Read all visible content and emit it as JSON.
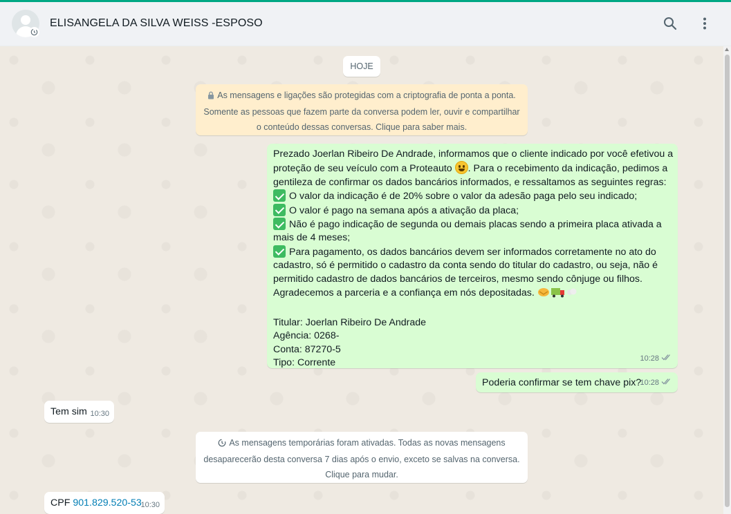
{
  "header": {
    "contact_name": "ELISANGELA DA SILVA WEISS -ESPOSO",
    "search_icon": "search-icon",
    "menu_icon": "more-vertical-icon"
  },
  "chat": {
    "date_chip": "HOJE",
    "encryption_note": [
      "As mensagens e ligações são protegidas com a criptografia de ponta a ponta.",
      "Somente as pessoas que fazem parte da conversa podem ler, ouvir e compartilhar",
      "o conteúdo dessas conversas. Clique para saber mais."
    ],
    "main_message": {
      "lines": [
        "Prezado Joerlan Ribeiro De Andrade, informamos que o cliente indicado por você efetivou a",
        "proteção de seu veículo com a Proteauto",
        ". Para o recebimento da indicação, pedimos a",
        "gentileza de confirmar os dados bancários informados, e  ressaltamos as seguintes regras:",
        "O valor da indicação é de 20% sobre o valor da adesão paga pelo seu indicado;",
        "O valor é pago na semana após a ativação da placa;",
        "Não é pago indicação de segunda ou demais placas sendo a primeira placa ativada a",
        "mais de 4 meses;",
        "Para pagamento, os dados bancários devem ser informados corretamente no ato do",
        "cadastro, só é permitido o cadastro da conta sendo do titular do cadastro, ou seja, não é",
        "permitido cadastro de dados bancários de terceiros, mesmo sendo cônjuge ou filhos.",
        "Agradecemos a parceria e a confiança em nós depositadas.",
        "Titular: Joerlan Ribeiro De Andrade",
        "Agência: 0268-",
        "Conta: 87270-5",
        "Tipo: Corrente"
      ],
      "time": "10:28"
    },
    "pix_message": {
      "text": "Poderia confirmar se tem chave pix?",
      "time": "10:28"
    },
    "temsim_message": {
      "text": "Tem sim",
      "time": "10:30"
    },
    "temporary_note": [
      "As mensagens temporárias foram ativadas. Todas as novas mensagens",
      "desaparecerão desta conversa 7 dias após o envio, exceto se salvas na conversa.",
      "Clique para mudar."
    ],
    "cpf_message": {
      "label": "CPF",
      "number": "901.829.520-53",
      "time": "10:30"
    }
  },
  "colors": {
    "accent": "#00a884",
    "outgoing_bubble": "#d9fdd3",
    "incoming_bubble": "#ffffff",
    "encryption_bg": "#ffeecd",
    "link": "#027eb5"
  }
}
